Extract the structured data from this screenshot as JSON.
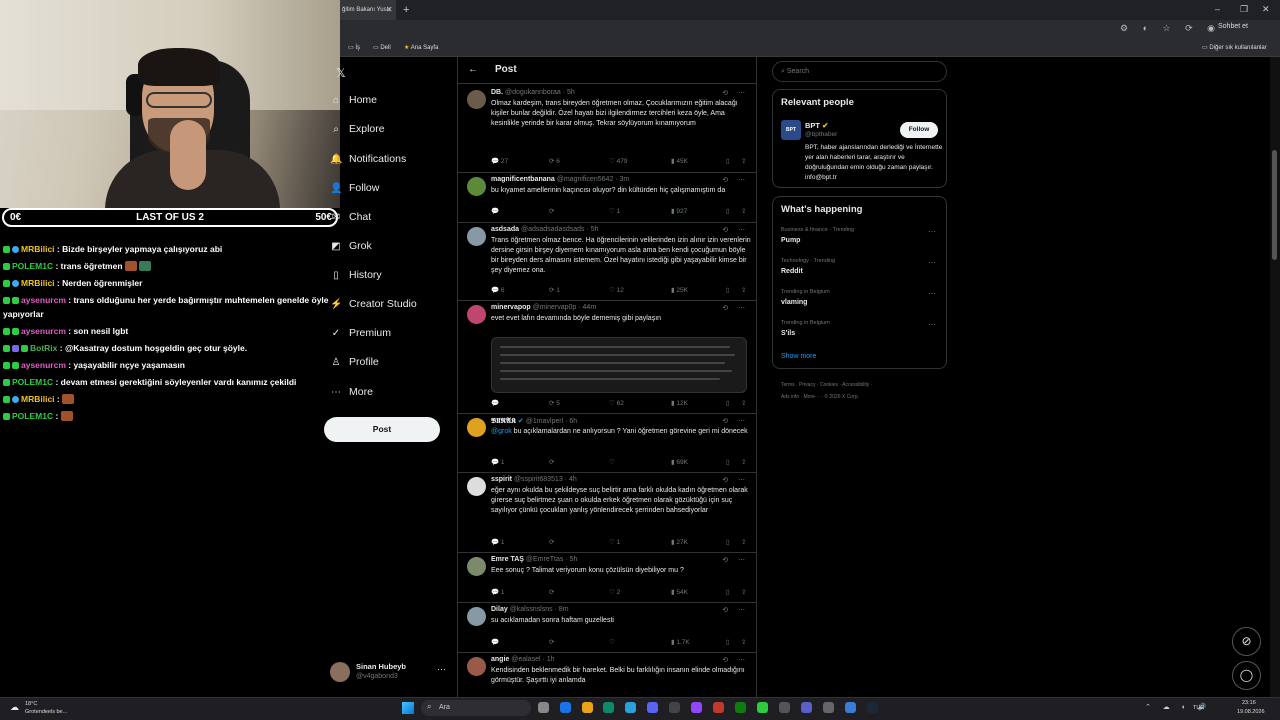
{
  "browser": {
    "tab_title": "ğitim Bakanı Yusu",
    "tab_close": "✕",
    "new_tab": "+",
    "window_controls": [
      "–",
      "❐",
      "✕"
    ],
    "address_icons": "⚙ ◐ ☆ ⟳ ◉",
    "chat_button": "Sohbet et",
    "bookmarks": [
      "İş",
      "Dell",
      "Ana Sayfa"
    ],
    "other_bookmarks": "Diğer sık kullanılanlar"
  },
  "stream_overlay": {
    "left_value": "0€",
    "title": "LAST OF US 2",
    "right_value": "50€"
  },
  "chat": [
    {
      "user": "MRBilici",
      "color": "#f0c420",
      "msg": "Bizde birşeyler yapmaya çalışıyoruz abi",
      "badges": [
        "green",
        "blue"
      ]
    },
    {
      "user": "POLEM1C",
      "color": "#2ecc40",
      "msg": "trans öğretmen",
      "badges": [
        "green"
      ]
    },
    {
      "user": "MRBilici",
      "color": "#f0c420",
      "msg": "Nerden öğrenmişler",
      "badges": [
        "green",
        "blue"
      ]
    },
    {
      "user": "aysenurcm",
      "color": "#e25cc8",
      "msg": "trans olduğunu her yerde bağırmıştır muhtemelen genelde öyle",
      "badges": [
        "green",
        "green"
      ]
    },
    {
      "user": "",
      "color": "#fff",
      "msg": "yapıyorlar",
      "badges": []
    },
    {
      "user": "aysenurcm",
      "color": "#e25cc8",
      "msg": "son nesil lgbt",
      "badges": [
        "green",
        "green"
      ]
    },
    {
      "user": "BotRix",
      "color": "#4caf50",
      "msg": "@Kasatray dostum hoşgeldin geç otur şöyle.",
      "badges": [
        "green",
        "purple",
        "green"
      ]
    },
    {
      "user": "aysenurcm",
      "color": "#e25cc8",
      "msg": "yaşayabilir nçye yaşamasın",
      "badges": [
        "green",
        "green"
      ]
    },
    {
      "user": "POLEM1C",
      "color": "#2ecc40",
      "msg": "devam etmesi gerektiğini söyleyenler vardı kanımız çekildi",
      "badges": [
        "green"
      ]
    },
    {
      "user": "MRBilici",
      "color": "#f0c420",
      "msg": "",
      "badges": [
        "green",
        "blue"
      ]
    },
    {
      "user": "POLEM1C",
      "color": "#2ecc40",
      "msg": "",
      "badges": [
        "green"
      ]
    }
  ],
  "nav": {
    "items": [
      {
        "label": "Home",
        "icon": "⌂"
      },
      {
        "label": "Explore",
        "icon": "⌕"
      },
      {
        "label": "Notifications",
        "icon": "🔔"
      },
      {
        "label": "Follow",
        "icon": "👤"
      },
      {
        "label": "Chat",
        "icon": "✉"
      },
      {
        "label": "Grok",
        "icon": "◩"
      },
      {
        "label": "History",
        "icon": "▯"
      },
      {
        "label": "Creator Studio",
        "icon": "⚡"
      },
      {
        "label": "Premium",
        "icon": "✓"
      },
      {
        "label": "Profile",
        "icon": "♙"
      },
      {
        "label": "More",
        "icon": "⋯"
      }
    ],
    "post_button": "Post",
    "profile_name": "Sinan Hubeyb",
    "profile_handle": "@v4gabond3",
    "profile_more": "···"
  },
  "timeline": {
    "back": "←",
    "title": "Post",
    "tweets": [
      {
        "name": "DB.",
        "handle": "@dogukannboraa · 5h",
        "text": "Olmaz kardeşim, trans bireyden öğretmen olmaz, Çocuklarımızın eğitim alacağı kişiler bunlar değildir. Özel hayatı bizi ilgilendirmez tercihleri keza öyle, Ama kesinlikle yerinde bir karar olmuş. Tekrar söylüyorum kınamıyorum",
        "replies": "27",
        "reposts": "6",
        "likes": "479",
        "views": "45K",
        "avatar_color": "#6b5b4b"
      },
      {
        "name": "magnificentbanana",
        "handle": "@magnificen5642 · 3m",
        "text": "bu kıyamet amellerinin kaçıncısı oluyor? din kültürden hiç çalışmamıştım da",
        "replies": "",
        "reposts": "",
        "likes": "1",
        "views": "927",
        "avatar_color": "#5a8a3a"
      },
      {
        "name": "asdsada",
        "handle": "@adsadsadasdsads · 5h",
        "text": "Trans öğretmen olmaz bence. Ha öğrencilerinin velilerinden izin alınır izin verenlerin dersine girsin birşey diyemem kınamıyorum asla ama ben kendi çocuğumun böyle bir bireyden ders almasını istemem. Özel hayatını istediği gibi yaşayabilir kimse bir şey diyemez ona.",
        "replies": "6",
        "reposts": "1",
        "likes": "12",
        "views": "25K",
        "avatar_color": "#8899a6"
      },
      {
        "name": "minervapop",
        "handle": "@minervap0p · 44m",
        "text": "evet evet lafın devamında böyle dememiş gibi paylaşın",
        "replies": "",
        "reposts": "5",
        "likes": "62",
        "views": "12K",
        "avatar_color": "#c0466e"
      },
      {
        "name": "𝕭𝖀𝕽𝕬𝕶",
        "handle": "@1mavlperl · 6h",
        "text_mention": "@grok",
        "text": " bu açıklamalardan ne anlıyorsun ? Yani öğretmen görevine geri mi dönecek",
        "replies": "1",
        "reposts": "",
        "likes": "",
        "views": "69K",
        "avatar_color": "#e0a020"
      },
      {
        "name": "sspirit",
        "handle": "@sspirit683513 · 4h",
        "text": "eğer aynı okulda bu şekildeyse suç belirtir ama farklı okulda kadın öğretmen olarak girerse suç belirtmez şuan o okulda erkek öğretmen olarak gözüktüğü için suç sayılıyor çünkü çocukları yanlış yönlendirecek şerrinden bahsediyorlar",
        "replies": "1",
        "reposts": "",
        "likes": "1",
        "views": "27K",
        "avatar_color": "#dddddd"
      },
      {
        "name": "Emre TAŞ",
        "handle": "@EmreTtas · 5h",
        "text": "Eee sonuç ? Talimat veriyorum konu çözülsün diyebiliyor mu ?",
        "replies": "1",
        "reposts": "",
        "likes": "2",
        "views": "54K",
        "avatar_color": "#7a8a6a"
      },
      {
        "name": "Dilay",
        "handle": "@kalssnslsns · 8m",
        "text": "su acıklamadan sonra haftam guzellesti",
        "replies": "",
        "reposts": "",
        "likes": "",
        "views": "1.7K",
        "avatar_color": "#8899a6"
      },
      {
        "name": "angie",
        "handle": "@ealasel · 1h",
        "text": "Kendisinden beklenmedik bir hareket. Belki bu farklılığın insanın elinde olmadığını görmüştür. Şaşırttı iyi anlamda",
        "replies": "",
        "reposts": "",
        "likes": "",
        "views": "",
        "avatar_color": "#9a5a4a"
      }
    ]
  },
  "right": {
    "search_placeholder": "Search",
    "relevant_title": "Relevant people",
    "bpt_logo": "BPT",
    "bpt_name": "BPT",
    "bpt_handle": "@bpthaber",
    "follow": "Follow",
    "bpt_bio": "BPT, haber ajanslarından derlediği ve İnternette yer alan haberleri tarar, araştırır ve doğruluğundan emin olduğu zaman paylaşır. info@bpt.tr",
    "happening_title": "What's happening",
    "trends": [
      {
        "context": "Business & finance · Trending",
        "name": "Pump"
      },
      {
        "context": "Technology · Trending",
        "name": "Reddit"
      },
      {
        "context": "Trending in Belgium",
        "name": "vlaming"
      },
      {
        "context": "Trending in Belgium",
        "name": "S'ils"
      }
    ],
    "show_more": "Show more",
    "footer_line1": "Terms · Privacy · Cookies · Accessibility ·",
    "footer_line2": "Ads info · More··· · © 2026 X Corp."
  },
  "taskbar": {
    "weather_temp": "18°C",
    "weather_desc": "Grotendeels be...",
    "search": "Ara",
    "tray": "⌃ ☁ ◐ 🔊",
    "lang": "TUR",
    "time": "23:16",
    "date": "19.08.2026"
  },
  "colors": {
    "accent": "#1d9bf0",
    "background": "#000000",
    "border": "#2f3336",
    "muted": "#71767b"
  }
}
